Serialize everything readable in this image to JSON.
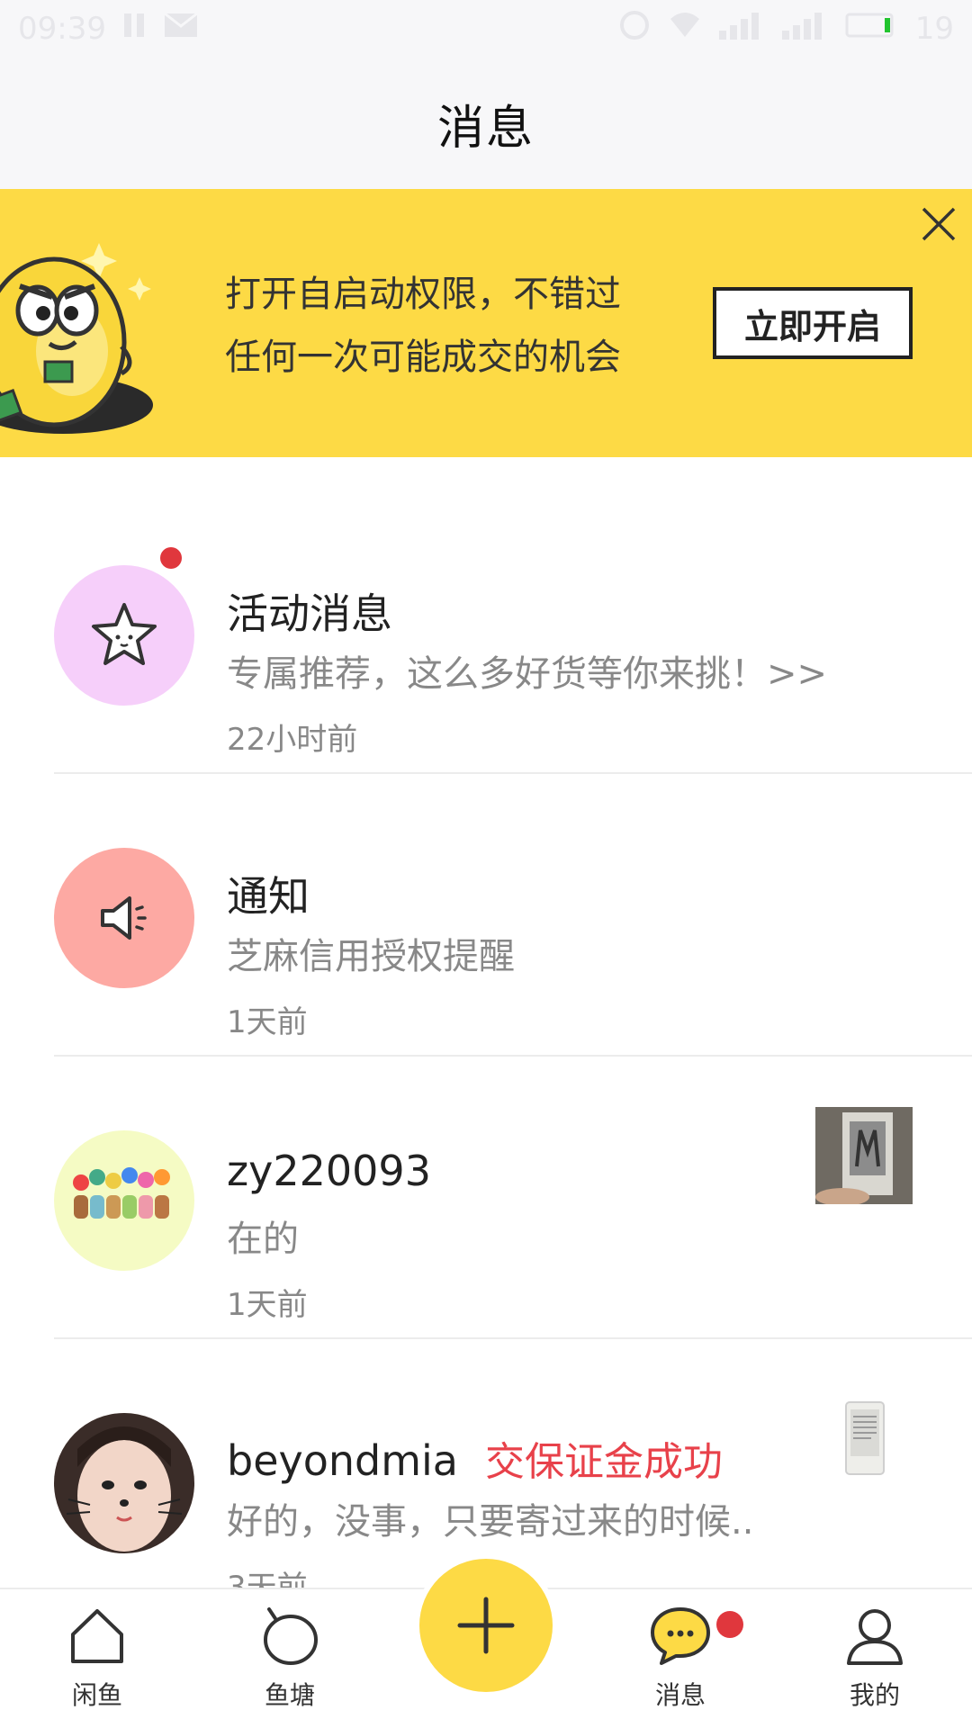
{
  "status_bar": {
    "time": "09:39",
    "battery": "19"
  },
  "header": {
    "title": "消息"
  },
  "banner": {
    "line1": "打开自启动权限，不错过",
    "line2": "任何一次可能成交的机会",
    "button_label": "立即开启",
    "background": "#fdda45"
  },
  "messages": [
    {
      "title": "活动消息",
      "preview": "专属推荐，这么多好货等你来挑！>>",
      "time": "22小时前",
      "avatar_color": "#f6cffa",
      "icon": "star-icon",
      "unread": true
    },
    {
      "title": "通知",
      "preview": "芝麻信用授权提醒",
      "time": "1天前",
      "avatar_color": "#fda9a3",
      "icon": "speaker-icon"
    },
    {
      "title": "zy220093",
      "preview": "在的",
      "time": "1天前",
      "avatar_color": "#f5fbc4"
    },
    {
      "title": "beyondmia",
      "badge": "交保证金成功",
      "preview": "好的，没事，只要寄过来的时候..",
      "time": "3天前"
    }
  ],
  "tabs": [
    {
      "label": "闲鱼",
      "icon": "home-icon"
    },
    {
      "label": "鱼塘",
      "icon": "pond-icon"
    },
    {
      "label": "消息",
      "icon": "message-icon",
      "unread": true
    },
    {
      "label": "我的",
      "icon": "profile-icon"
    }
  ],
  "fab": {
    "icon": "plus-icon",
    "color": "#fdda45"
  }
}
